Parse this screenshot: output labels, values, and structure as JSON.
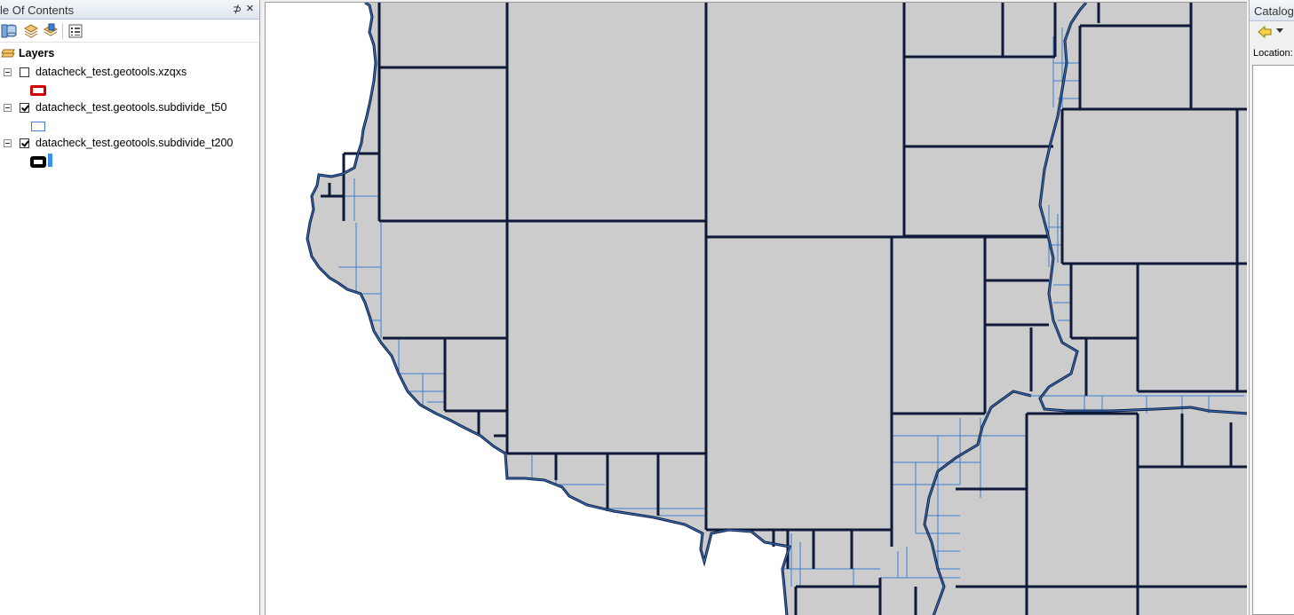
{
  "toc": {
    "title": "le Of Contents",
    "pin_glyph": "⊅",
    "close_glyph": "×",
    "toolbar_icons": [
      "list-by-drawing-order-icon",
      "list-by-source-icon",
      "list-by-visibility-icon",
      "list-by-selection-icon",
      "options-icon"
    ],
    "root_label": "Layers",
    "layers": [
      {
        "name": "datacheck_test.geotools.xzqxs",
        "checked": false,
        "symbol": "red-outline-rect",
        "symbol_color": "#d40000"
      },
      {
        "name": "datacheck_test.geotools.subdivide_t50",
        "checked": true,
        "symbol": "blue-outline-rect",
        "symbol_color": "#3a7fd5"
      },
      {
        "name": "datacheck_test.geotools.subdivide_t200",
        "checked": true,
        "symbol": "black-outline-rect",
        "symbol_color": "#000000"
      }
    ]
  },
  "map": {
    "fill_color": "#cccccc",
    "thick_outline_color": "#0f1a3a",
    "thin_outline_color": "#3a7fd5"
  },
  "catalog": {
    "title": "Catalog",
    "location_label": "Location:",
    "toolbar_icons": [
      "back-arrow-icon",
      "dropdown-icon"
    ]
  }
}
